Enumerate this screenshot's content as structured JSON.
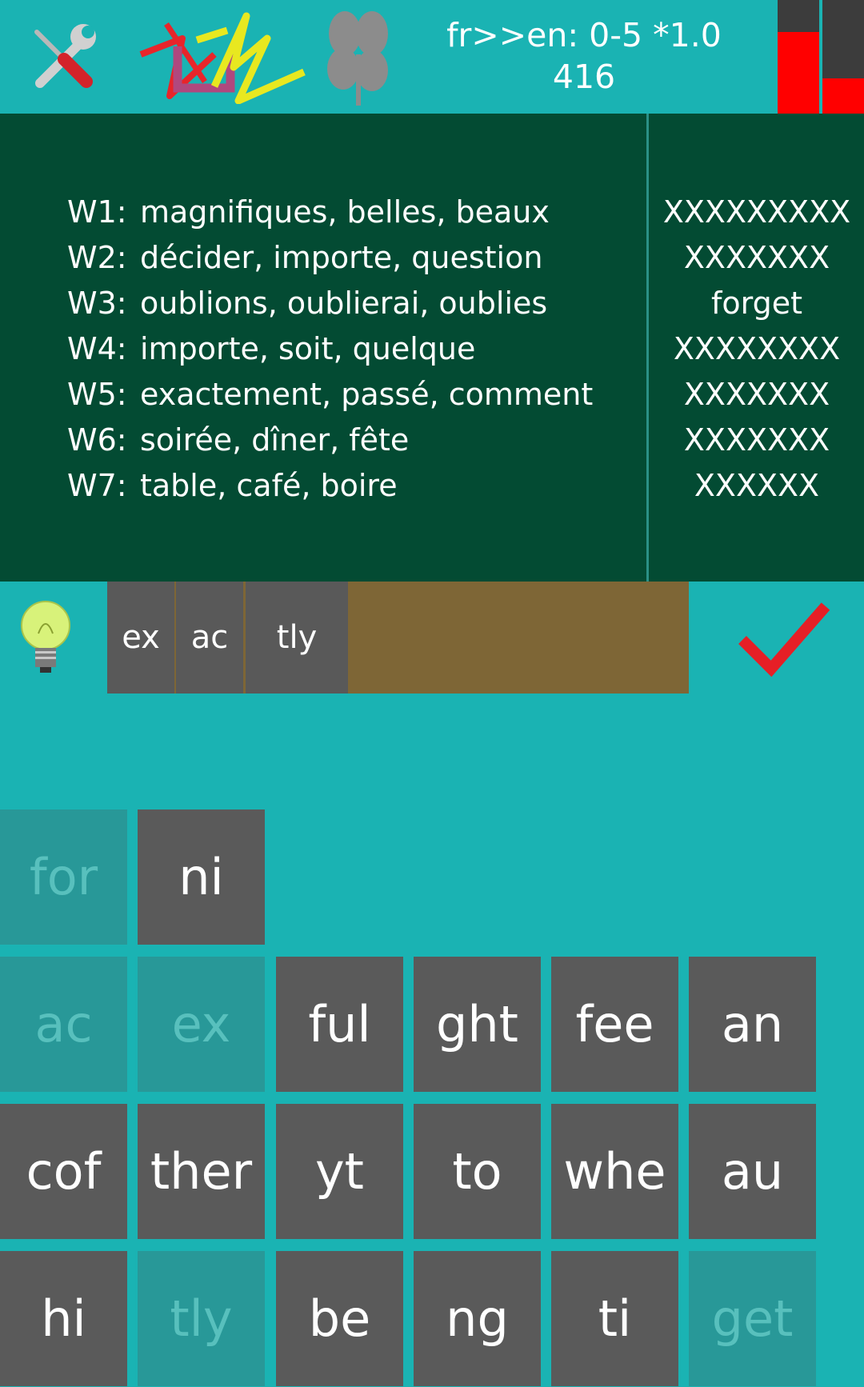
{
  "header": {
    "mode": "fr>>en: 0-5 *1.0",
    "score": "416"
  },
  "meter_colors": [
    "#3c3c3c",
    "#ff0000",
    "#3c3c3c",
    "#ff0000"
  ],
  "icons": {
    "tools": "tools-icon",
    "logo": "app-logo",
    "clover": "clover-icon",
    "hint": "lightbulb-icon",
    "submit": "checkmark-icon"
  },
  "words": [
    {
      "label": "W1:",
      "text": "magnifiques, belles, beaux",
      "answer": "XXXXXXXXX"
    },
    {
      "label": "W2:",
      "text": "décider, importe, question",
      "answer": "XXXXXXX"
    },
    {
      "label": "W3:",
      "text": "oublions, oublierai, oublies",
      "answer": "forget"
    },
    {
      "label": "W4:",
      "text": "importe, soit, quelque",
      "answer": "XXXXXXXX"
    },
    {
      "label": "W5:",
      "text": "exactement, passé, comment",
      "answer": "XXXXXXX"
    },
    {
      "label": "W6:",
      "text": "soirée, dîner, fête",
      "answer": "XXXXXXX"
    },
    {
      "label": "W7:",
      "text": "table, café, boire",
      "answer": "XXXXXX"
    }
  ],
  "answer_chips": [
    "ex",
    "ac",
    "tly"
  ],
  "keys": [
    {
      "label": "for",
      "used": true
    },
    {
      "label": "ni",
      "used": false
    },
    {
      "label": "ac",
      "used": true
    },
    {
      "label": "ex",
      "used": true
    },
    {
      "label": "ful",
      "used": false
    },
    {
      "label": "ght",
      "used": false
    },
    {
      "label": "fee",
      "used": false
    },
    {
      "label": "an",
      "used": false
    },
    {
      "label": "cof",
      "used": false
    },
    {
      "label": "ther",
      "used": false
    },
    {
      "label": "yt",
      "used": false
    },
    {
      "label": "to",
      "used": false
    },
    {
      "label": "whe",
      "used": false
    },
    {
      "label": "au",
      "used": false
    },
    {
      "label": "hi",
      "used": false
    },
    {
      "label": "tly",
      "used": true
    },
    {
      "label": "be",
      "used": false
    },
    {
      "label": "ng",
      "used": false
    },
    {
      "label": "ti",
      "used": false
    },
    {
      "label": "get",
      "used": true
    }
  ]
}
